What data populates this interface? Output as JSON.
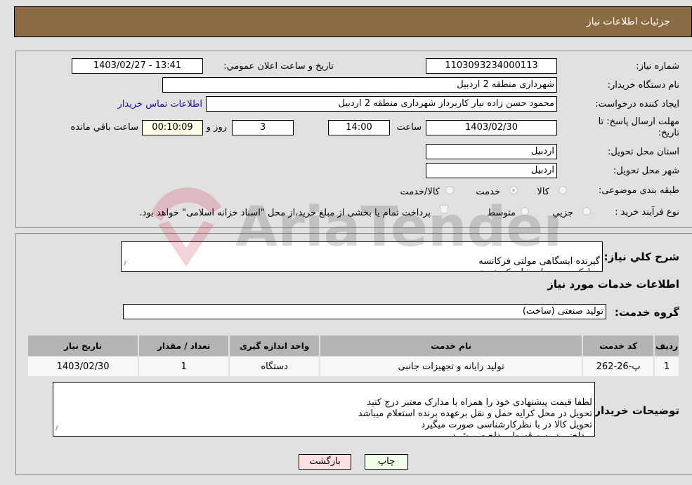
{
  "header": {
    "title": "جزئیات اطلاعات نیاز"
  },
  "form": {
    "need_number": {
      "label": "شماره نیاز:",
      "value": "1103093234000113"
    },
    "announce_datetime": {
      "label": "تاریخ و ساعت اعلان عمومي:",
      "value": "1403/02/27 - 13:41"
    },
    "buyer_org": {
      "label": "نام دستگاه خریدار:",
      "value": "شهرداری منطقه 2 اردبیل"
    },
    "requester": {
      "label": "ایجاد کننده درخواست:",
      "value": "محمود حسن زاده نیار کاربرداز شهرداری منطقه 2 اردبیل"
    },
    "buyer_contact_link": "اطلاعات تماس خریدار",
    "deadline": {
      "label_line1": "مهلت ارسال پاسخ: تا",
      "label_line2": "تاریخ:",
      "date": "1403/02/30",
      "time_label": "ساعت",
      "time": "14:00",
      "days": "3",
      "days_label": "روز و",
      "remaining": "00:10:09",
      "remaining_label": "ساعت باقي مانده"
    },
    "province": {
      "label": "استان محل تحویل:",
      "value": "اردبیل"
    },
    "city": {
      "label": "شهر محل تحویل:",
      "value": "اردبیل"
    },
    "category": {
      "label": "طبقه بندی موضوعی:",
      "options": [
        "کالا",
        "خدمت",
        "کالا/خدمت"
      ],
      "selected": "خدمت"
    },
    "purchase_type": {
      "label": "نوع فرآیند خرید :",
      "options": [
        "جزيي",
        "متوسط"
      ],
      "payment_note": "پرداخت تمام یا بخشی از مبلغ خرید،از محل \"اسناد خزانه اسلامی\" خواهد بود."
    }
  },
  "description": {
    "label": "شرح کلي نیاز:",
    "value": "گیرنده ایسگاهی مولتی فرکانسه\nمدارک پیوست / مشابه کد خدمتی"
  },
  "services_section": {
    "title": "اطلاعات خدمات مورد نیاز",
    "group_label": "گروه خدمت:",
    "group_value": "تولید صنعتی (ساخت)"
  },
  "table": {
    "headers": [
      "ردیف",
      "کد خدمت",
      "نام خدمت",
      "واحد اندازه گیری",
      "تعداد / مقدار",
      "تاریخ نیاز"
    ],
    "rows": [
      [
        "1",
        "پ-26-262",
        "تولید رایانه و تجهیزات جانبی",
        "دستگاه",
        "1",
        "1403/02/30"
      ]
    ]
  },
  "buyer_notes": {
    "label": "توضیحات خریدار:",
    "value": "لطفا قیمت پیشنهادی خود را همراه با مدارک معتبر درج کنید\nتحویل در محل کرایه حمل و نقل برعهده برنده استعلام میباشد\nتحویل کالا در با نظرکارشناسی صورت میگیرد\nپرداختی در سه قسط پرداخت میشود"
  },
  "buttons": {
    "print": "چاپ",
    "back": "بازگشت"
  },
  "colors": {
    "header_bg": "#8b6c42",
    "print_bg": "#efffea",
    "back_bg": "#ffe1e1",
    "remaining_bg": "#ffffe8"
  },
  "watermark": "AriaTender.net"
}
